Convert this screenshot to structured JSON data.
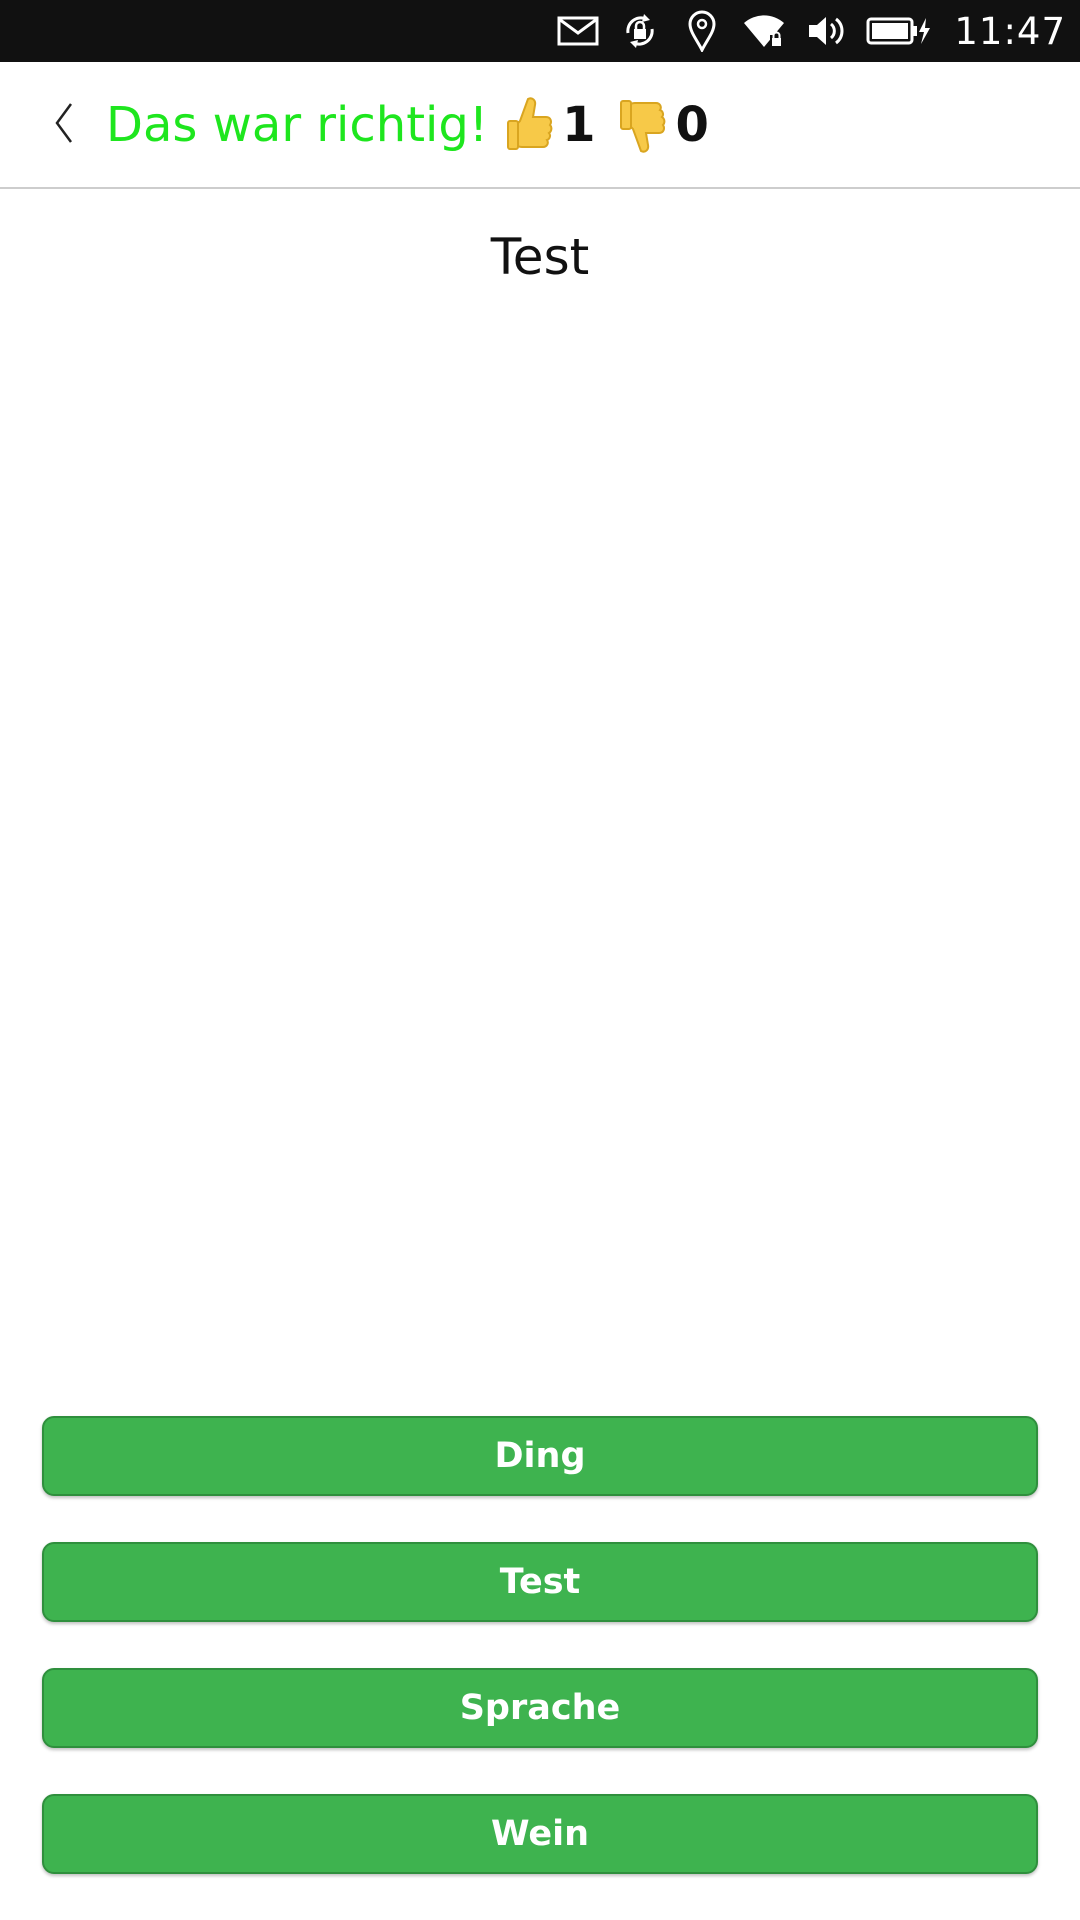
{
  "status_bar": {
    "icons": [
      "mail-icon",
      "rotation-lock-icon",
      "location-icon",
      "wifi-secure-icon",
      "volume-icon",
      "battery-charging-icon"
    ],
    "time": "11:47"
  },
  "header": {
    "back_icon": "chevron-left-icon",
    "result_text": "Das war richtig!",
    "result_color": "#1ee61e",
    "correct_count": "1",
    "wrong_count": "0",
    "thumbs_up_icon": "thumbs-up-icon",
    "thumbs_down_icon": "thumbs-down-icon"
  },
  "question": {
    "word": "Test"
  },
  "answers": [
    {
      "label": "Ding"
    },
    {
      "label": "Test"
    },
    {
      "label": "Sprache"
    },
    {
      "label": "Wein"
    }
  ],
  "colors": {
    "button": "#3eb34f",
    "status_bar": "#111111"
  }
}
